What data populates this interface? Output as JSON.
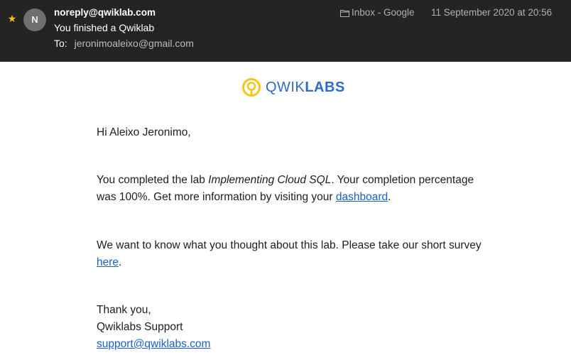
{
  "message": {
    "sender": "noreply@qwiklab.com",
    "avatar_initial": "N",
    "subject": "You finished a Qwiklab",
    "to_label": "To:",
    "to_address": "jeronimoaleixo@gmail.com",
    "mailbox": "Inbox - Google",
    "date": "11 September 2020 at 20:56",
    "flag_icon": "star-icon",
    "flag_color": "#f2c318"
  },
  "logo": {
    "text_light": "QWIK",
    "text_bold": "LABS",
    "primary_color": "#2d6ac9",
    "accent_color": "#f5c518"
  },
  "email_body": {
    "greeting": "Hi Aleixo Jeronimo,",
    "completion_prefix": "You completed the lab ",
    "lab_name": "Implementing Cloud SQL",
    "completion_middle": ". Your completion percentage was 100%. Get more information by visiting your ",
    "dashboard_link": "dashboard",
    "completion_suffix": ".",
    "survey_prefix": "We want to know what you thought about this lab. Please take our short survey ",
    "survey_link": "here",
    "survey_suffix": ".",
    "closing": "Thank you,",
    "signature": "Qwiklabs Support",
    "support_email": "support@qwiklabs.com"
  }
}
